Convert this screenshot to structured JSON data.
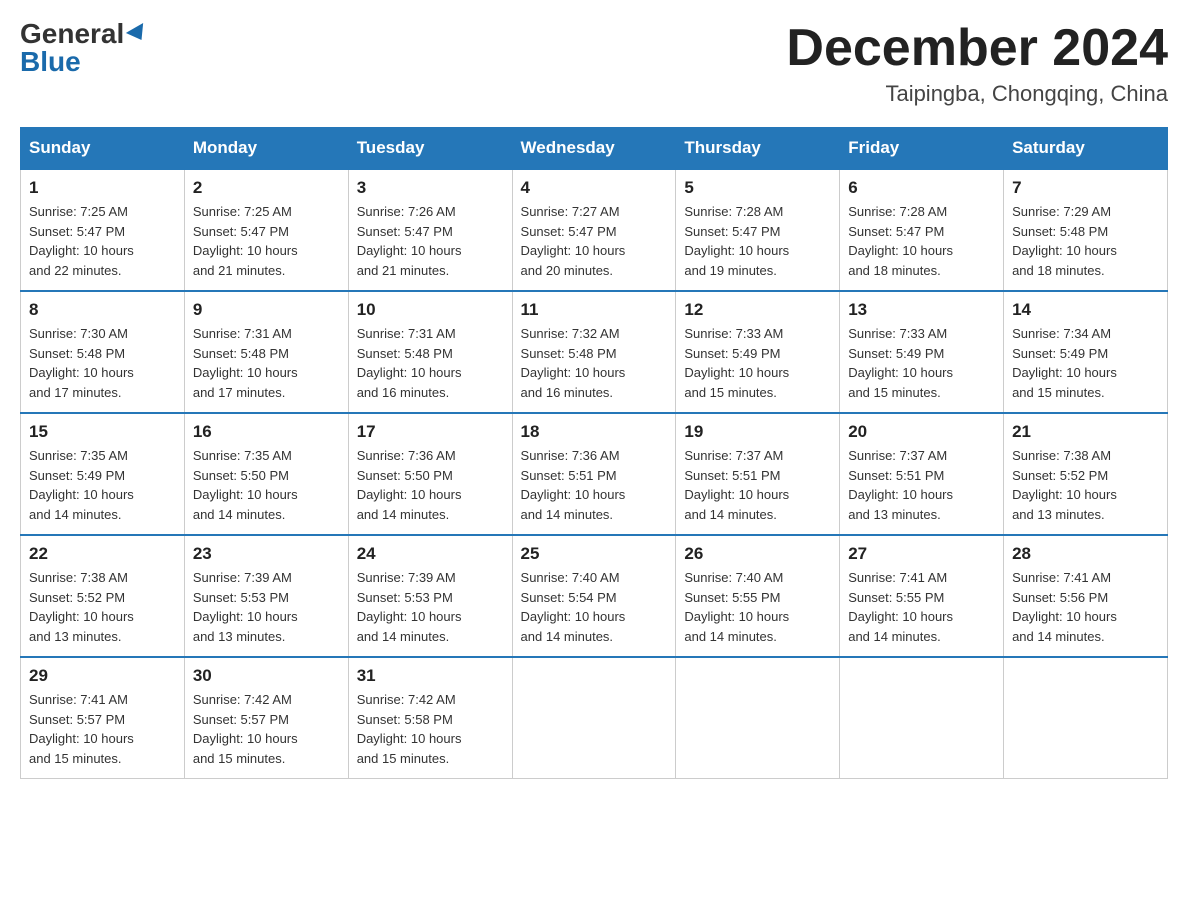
{
  "header": {
    "logo_general": "General",
    "logo_blue": "Blue",
    "month_title": "December 2024",
    "subtitle": "Taipingba, Chongqing, China"
  },
  "days_of_week": [
    "Sunday",
    "Monday",
    "Tuesday",
    "Wednesday",
    "Thursday",
    "Friday",
    "Saturday"
  ],
  "weeks": [
    [
      {
        "day": "1",
        "sunrise": "7:25 AM",
        "sunset": "5:47 PM",
        "daylight": "10 hours and 22 minutes."
      },
      {
        "day": "2",
        "sunrise": "7:25 AM",
        "sunset": "5:47 PM",
        "daylight": "10 hours and 21 minutes."
      },
      {
        "day": "3",
        "sunrise": "7:26 AM",
        "sunset": "5:47 PM",
        "daylight": "10 hours and 21 minutes."
      },
      {
        "day": "4",
        "sunrise": "7:27 AM",
        "sunset": "5:47 PM",
        "daylight": "10 hours and 20 minutes."
      },
      {
        "day": "5",
        "sunrise": "7:28 AM",
        "sunset": "5:47 PM",
        "daylight": "10 hours and 19 minutes."
      },
      {
        "day": "6",
        "sunrise": "7:28 AM",
        "sunset": "5:47 PM",
        "daylight": "10 hours and 18 minutes."
      },
      {
        "day": "7",
        "sunrise": "7:29 AM",
        "sunset": "5:48 PM",
        "daylight": "10 hours and 18 minutes."
      }
    ],
    [
      {
        "day": "8",
        "sunrise": "7:30 AM",
        "sunset": "5:48 PM",
        "daylight": "10 hours and 17 minutes."
      },
      {
        "day": "9",
        "sunrise": "7:31 AM",
        "sunset": "5:48 PM",
        "daylight": "10 hours and 17 minutes."
      },
      {
        "day": "10",
        "sunrise": "7:31 AM",
        "sunset": "5:48 PM",
        "daylight": "10 hours and 16 minutes."
      },
      {
        "day": "11",
        "sunrise": "7:32 AM",
        "sunset": "5:48 PM",
        "daylight": "10 hours and 16 minutes."
      },
      {
        "day": "12",
        "sunrise": "7:33 AM",
        "sunset": "5:49 PM",
        "daylight": "10 hours and 15 minutes."
      },
      {
        "day": "13",
        "sunrise": "7:33 AM",
        "sunset": "5:49 PM",
        "daylight": "10 hours and 15 minutes."
      },
      {
        "day": "14",
        "sunrise": "7:34 AM",
        "sunset": "5:49 PM",
        "daylight": "10 hours and 15 minutes."
      }
    ],
    [
      {
        "day": "15",
        "sunrise": "7:35 AM",
        "sunset": "5:49 PM",
        "daylight": "10 hours and 14 minutes."
      },
      {
        "day": "16",
        "sunrise": "7:35 AM",
        "sunset": "5:50 PM",
        "daylight": "10 hours and 14 minutes."
      },
      {
        "day": "17",
        "sunrise": "7:36 AM",
        "sunset": "5:50 PM",
        "daylight": "10 hours and 14 minutes."
      },
      {
        "day": "18",
        "sunrise": "7:36 AM",
        "sunset": "5:51 PM",
        "daylight": "10 hours and 14 minutes."
      },
      {
        "day": "19",
        "sunrise": "7:37 AM",
        "sunset": "5:51 PM",
        "daylight": "10 hours and 14 minutes."
      },
      {
        "day": "20",
        "sunrise": "7:37 AM",
        "sunset": "5:51 PM",
        "daylight": "10 hours and 13 minutes."
      },
      {
        "day": "21",
        "sunrise": "7:38 AM",
        "sunset": "5:52 PM",
        "daylight": "10 hours and 13 minutes."
      }
    ],
    [
      {
        "day": "22",
        "sunrise": "7:38 AM",
        "sunset": "5:52 PM",
        "daylight": "10 hours and 13 minutes."
      },
      {
        "day": "23",
        "sunrise": "7:39 AM",
        "sunset": "5:53 PM",
        "daylight": "10 hours and 13 minutes."
      },
      {
        "day": "24",
        "sunrise": "7:39 AM",
        "sunset": "5:53 PM",
        "daylight": "10 hours and 14 minutes."
      },
      {
        "day": "25",
        "sunrise": "7:40 AM",
        "sunset": "5:54 PM",
        "daylight": "10 hours and 14 minutes."
      },
      {
        "day": "26",
        "sunrise": "7:40 AM",
        "sunset": "5:55 PM",
        "daylight": "10 hours and 14 minutes."
      },
      {
        "day": "27",
        "sunrise": "7:41 AM",
        "sunset": "5:55 PM",
        "daylight": "10 hours and 14 minutes."
      },
      {
        "day": "28",
        "sunrise": "7:41 AM",
        "sunset": "5:56 PM",
        "daylight": "10 hours and 14 minutes."
      }
    ],
    [
      {
        "day": "29",
        "sunrise": "7:41 AM",
        "sunset": "5:57 PM",
        "daylight": "10 hours and 15 minutes."
      },
      {
        "day": "30",
        "sunrise": "7:42 AM",
        "sunset": "5:57 PM",
        "daylight": "10 hours and 15 minutes."
      },
      {
        "day": "31",
        "sunrise": "7:42 AM",
        "sunset": "5:58 PM",
        "daylight": "10 hours and 15 minutes."
      },
      null,
      null,
      null,
      null
    ]
  ],
  "labels": {
    "sunrise": "Sunrise:",
    "sunset": "Sunset:",
    "daylight": "Daylight:"
  }
}
